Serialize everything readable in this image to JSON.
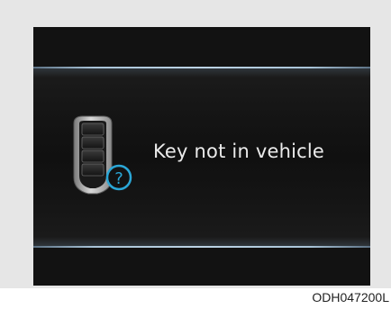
{
  "display": {
    "message": "Key not in vehicle",
    "icon": "smart-key-question-icon"
  },
  "figure": {
    "code": "ODH047200L"
  },
  "colors": {
    "screen_background": "#121212",
    "accent_line": "#bcd3e4",
    "question_badge": "#2aa6d6",
    "text": "#ebebeb"
  }
}
